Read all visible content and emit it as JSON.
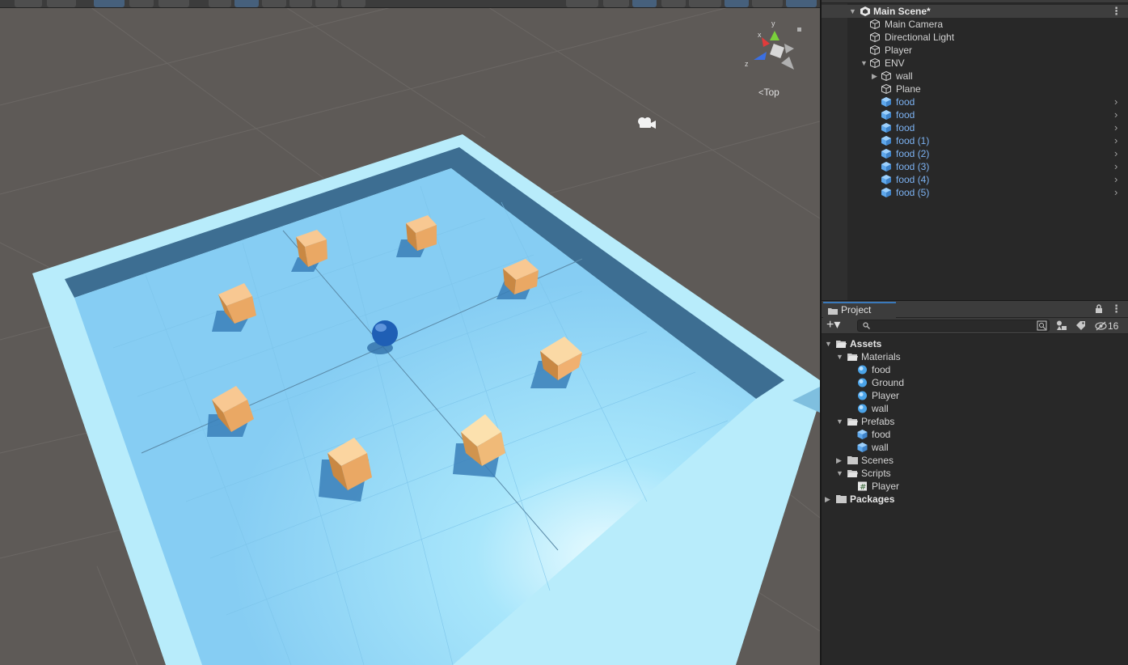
{
  "hierarchy": {
    "scene": "Main Scene*",
    "items": [
      {
        "label": "Main Camera"
      },
      {
        "label": "Directional Light"
      },
      {
        "label": "Player"
      },
      {
        "label": "ENV"
      },
      {
        "label": "wall"
      },
      {
        "label": "Plane"
      },
      {
        "label": "food"
      },
      {
        "label": "food"
      },
      {
        "label": "food"
      },
      {
        "label": "food (1)"
      },
      {
        "label": "food (2)"
      },
      {
        "label": "food (3)"
      },
      {
        "label": "food (4)"
      },
      {
        "label": "food (5)"
      }
    ]
  },
  "scene_view": {
    "view_label": "Top",
    "axis_x": "x",
    "axis_y": "y",
    "axis_z": "z"
  },
  "project": {
    "tab": "Project",
    "add_label": "+▾",
    "search_placeholder": "",
    "hidden_packages_count": "16",
    "tree": [
      {
        "label": "Assets"
      },
      {
        "label": "Materials"
      },
      {
        "label": "food"
      },
      {
        "label": "Ground"
      },
      {
        "label": "Player"
      },
      {
        "label": "wall"
      },
      {
        "label": "Prefabs"
      },
      {
        "label": "food"
      },
      {
        "label": "wall"
      },
      {
        "label": "Scenes"
      },
      {
        "label": "Scripts"
      },
      {
        "label": "Player"
      },
      {
        "label": "Packages"
      }
    ]
  },
  "colors": {
    "prefab_text": "#7cb2f2",
    "floor": "#8fd6f8",
    "wall": "#a9e2f7",
    "food_cube": "#f0b070",
    "player_sphere": "#1f5fb5",
    "accent": "#3a79bb"
  },
  "icons": {
    "scene": "unity-scene-icon",
    "gameobject": "gameobject-cube-icon",
    "prefab": "prefab-cube-icon",
    "folder": "folder-icon",
    "material": "material-sphere-icon",
    "script": "csharp-script-icon"
  }
}
